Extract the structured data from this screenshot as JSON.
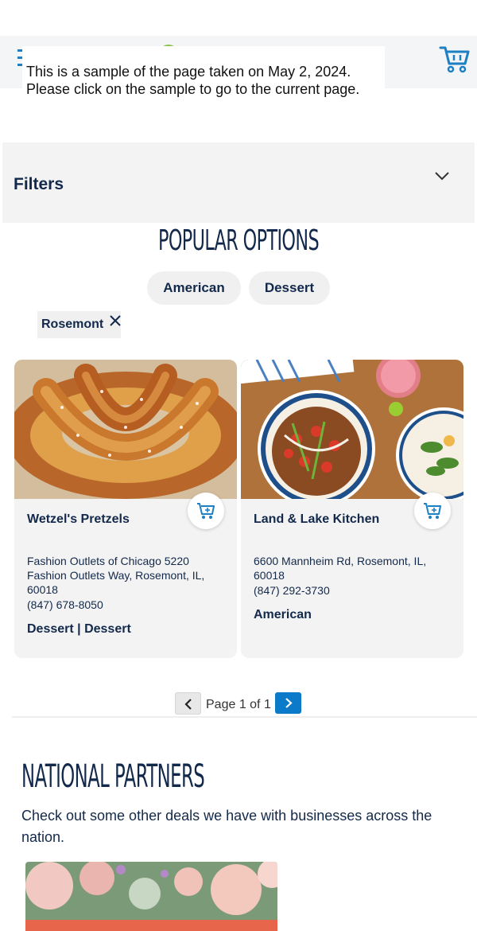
{
  "header": {
    "banner_text": "This is a sample of the page taken on May 2, 2024. Please click on the sample to go to the current page.",
    "menu_icon": "hamburger-icon",
    "cart_icon": "shopping-cart-icon"
  },
  "filters": {
    "label": "Filters",
    "toggle_icon": "chevron-down-icon"
  },
  "popular": {
    "title": "POPULAR OPTIONS",
    "pills": [
      "American",
      "Dessert"
    ]
  },
  "active_filter": {
    "label": "Rosemont",
    "remove_icon": "close-icon"
  },
  "listings": [
    {
      "name": "Wetzel's Pretzels",
      "address": "Fashion Outlets of Chicago 5220 Fashion Outlets Way, Rosemont, IL, 60018",
      "phone": "(847) 678-8050",
      "category": "Dessert | Dessert",
      "image": "pretzel-photo"
    },
    {
      "name": "Land & Lake Kitchen",
      "address": "6600 Mannheim Rd, Rosemont, IL, 60018",
      "phone": "(847) 292-3730",
      "category": "American",
      "image": "food-bowl-photo"
    }
  ],
  "pagination": {
    "text": "Page 1 of 1",
    "prev_icon": "chevron-left-icon",
    "next_icon": "chevron-right-icon"
  },
  "national_partners": {
    "title": "NATIONAL PARTNERS",
    "description": "Check out some other deals we have with businesses across the nation."
  },
  "colors": {
    "navy": "#13294b",
    "accent_blue": "#0b7ac8",
    "card_bg": "#f3f3f3"
  }
}
